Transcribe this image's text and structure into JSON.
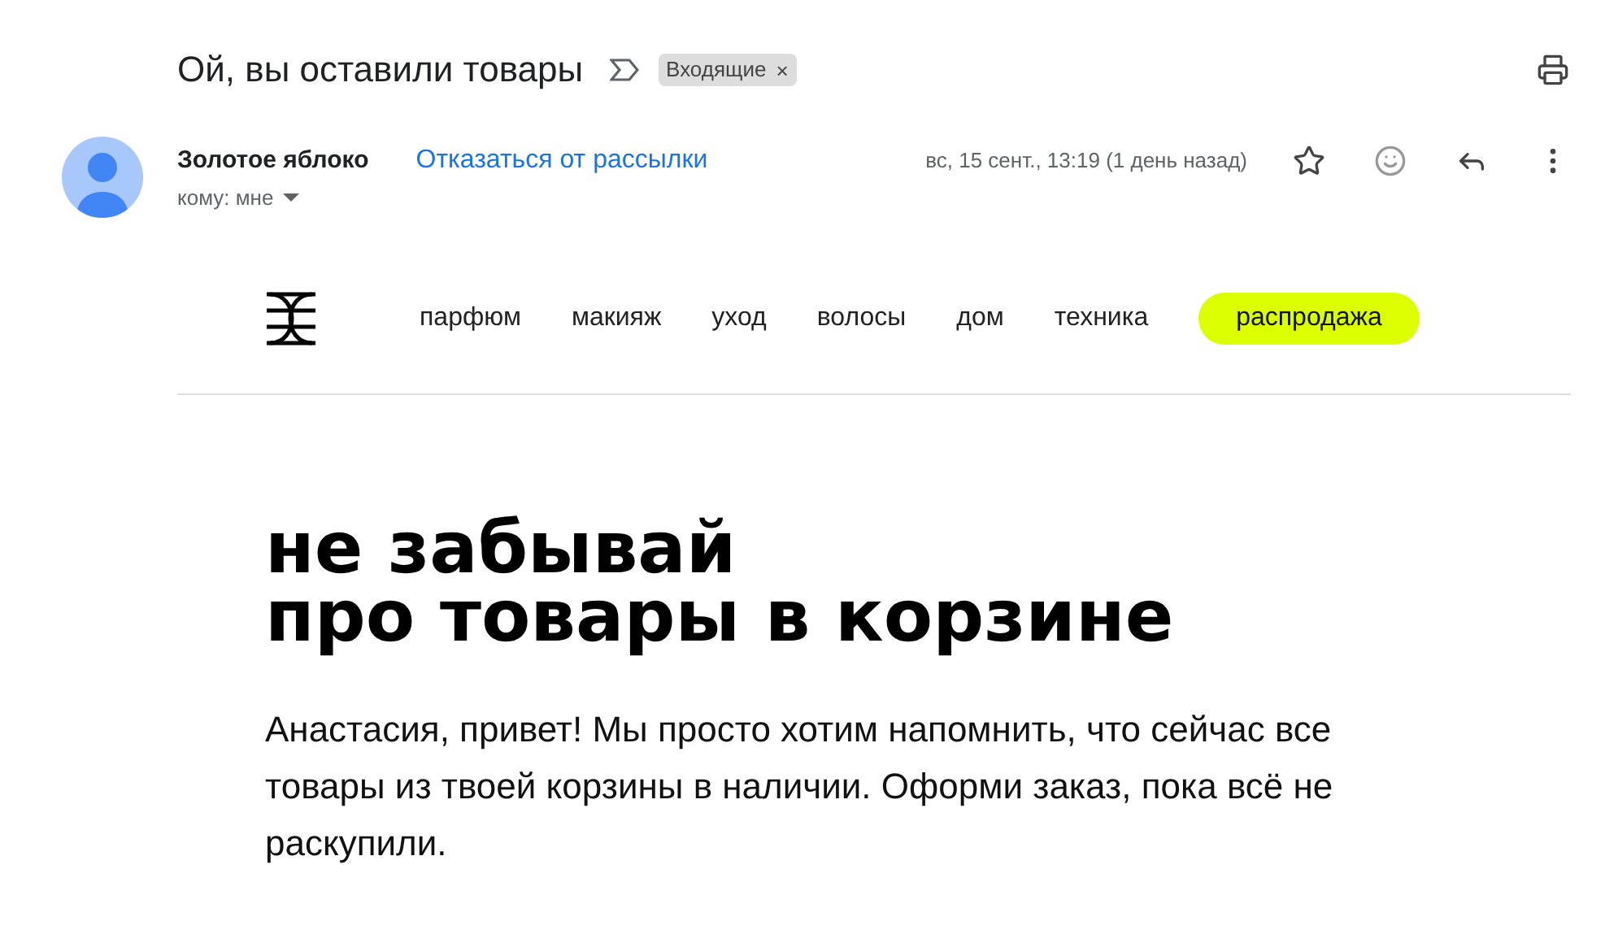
{
  "subject": "Ой, вы оставили товары",
  "label": "Входящие",
  "label_close": "×",
  "sender": {
    "name": "Золотое яблоко",
    "unsubscribe": "Отказаться от рассылки",
    "to": "кому: мне",
    "date": "вс, 15 сент., 13:19 (1 день назад)",
    "starred": false
  },
  "nav": [
    {
      "label": "парфюм",
      "kind": "link"
    },
    {
      "label": "макияж",
      "kind": "link"
    },
    {
      "label": "уход",
      "kind": "link"
    },
    {
      "label": "волосы",
      "kind": "link"
    },
    {
      "label": "дом",
      "kind": "link"
    },
    {
      "label": "техника",
      "kind": "link"
    },
    {
      "label": "распродажа",
      "kind": "highlight"
    }
  ],
  "heading": [
    "не забывай",
    "про товары в корзине"
  ],
  "body": "Анастасия, привет! Мы просто хотим напомнить, что сейчас все товары из твоей корзины в наличии. Оформи заказ, пока всё не раскупили."
}
